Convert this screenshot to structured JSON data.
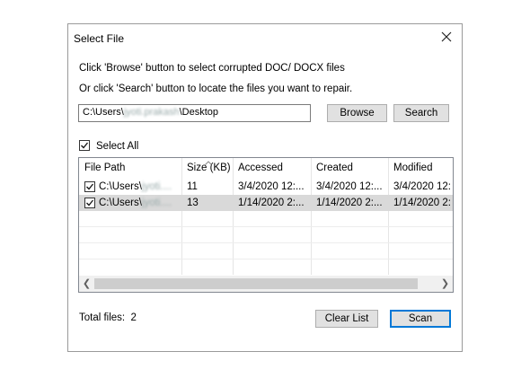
{
  "dialog": {
    "title": "Select File",
    "line1": "Click 'Browse' button to select corrupted DOC/ DOCX files",
    "line2": "Or click 'Search' button to locate the files you want to repair.",
    "path_prefix": "C:\\Users\\",
    "path_blurred": "jyoti.prakash",
    "path_suffix": "\\Desktop",
    "browse_label": "Browse",
    "search_label": "Search",
    "select_all_label": "Select All",
    "total_files_label": "Total files:",
    "total_files_value": "2",
    "clear_list_label": "Clear List",
    "scan_label": "Scan"
  },
  "table": {
    "columns": [
      "File Path",
      "Size (KB)",
      "Accessed",
      "Created",
      "Modified"
    ],
    "rows": [
      {
        "path_prefix": "C:\\Users\\",
        "path_blurred": "jyoti....",
        "size": "11",
        "accessed": "3/4/2020 12:...",
        "created": "3/4/2020 12:...",
        "modified": "3/4/2020 12:",
        "checked": true,
        "selected": false
      },
      {
        "path_prefix": "C:\\Users\\",
        "path_blurred": "jyoti....",
        "size": "13",
        "accessed": "1/14/2020 2:...",
        "created": "1/14/2020 2:...",
        "modified": "1/14/2020 2:",
        "checked": true,
        "selected": true
      }
    ]
  },
  "icons": {
    "close": "close-icon",
    "sort": "sort-up-icon",
    "scroll_left": "scroll-left-icon",
    "scroll_right": "scroll-right-icon"
  },
  "colors": {
    "accent": "#0078d7",
    "selected_row": "#d9d9d9",
    "button_face": "#e1e1e1"
  }
}
